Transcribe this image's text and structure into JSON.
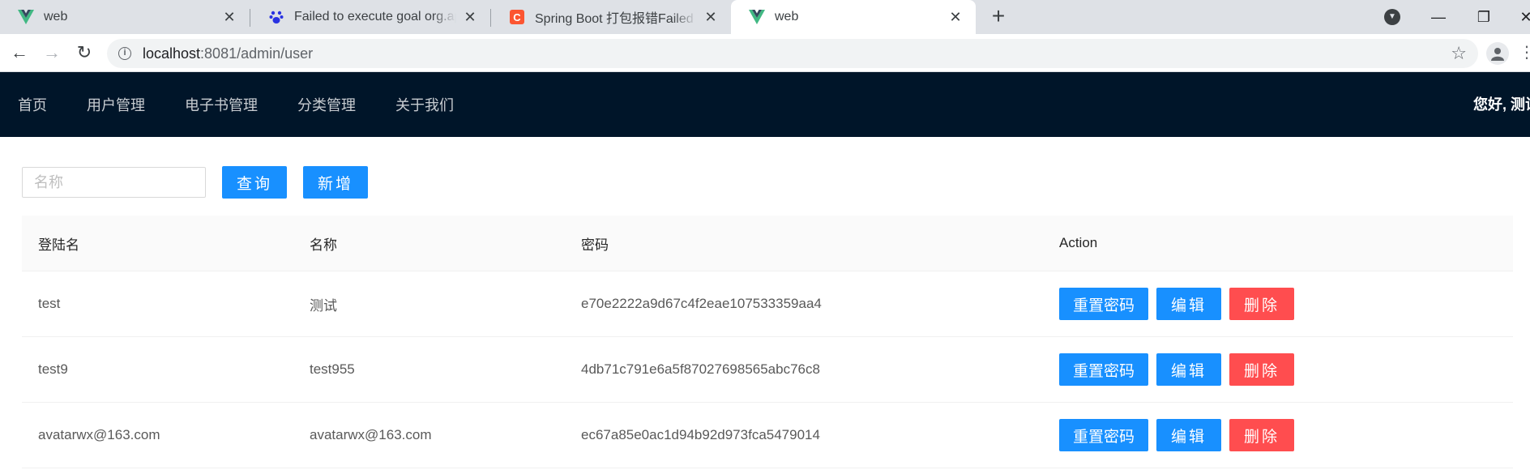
{
  "browser": {
    "tabs": [
      {
        "title": "web",
        "icon": "vue-icon"
      },
      {
        "title": "Failed to execute goal org.apache",
        "icon": "baidu-paw-icon"
      },
      {
        "title": "Spring Boot 打包报错Failed to execute",
        "icon": "csdn-icon"
      },
      {
        "title": "web",
        "icon": "vue-icon"
      }
    ],
    "address": {
      "host": "localhost",
      "path": ":8081/admin/user"
    },
    "colors": {
      "vue_green": "#41b883",
      "vue_dark": "#35495e",
      "csdn_red": "#fc5531",
      "baidu_blue": "#2932e1"
    }
  },
  "header": {
    "nav": [
      "首页",
      "用户管理",
      "电子书管理",
      "分类管理",
      "关于我们"
    ],
    "greeting": "您好, 测试"
  },
  "toolbar": {
    "search_placeholder": "名称",
    "query_label": "查询",
    "add_label": "新增"
  },
  "table": {
    "columns": [
      "登陆名",
      "名称",
      "密码",
      "Action"
    ],
    "rows": [
      {
        "login": "test",
        "name": "测试",
        "password": "e70e2222a9d67c4f2eae107533359aa4"
      },
      {
        "login": "test9",
        "name": "test955",
        "password": "4db71c791e6a5f87027698565abc76c8"
      },
      {
        "login": "avatarwx@163.com",
        "name": "avatarwx@163.com",
        "password": "ec67a85e0ac1d94b92d973fca5479014"
      }
    ],
    "actions": {
      "reset": "重置密码",
      "edit": "编辑",
      "delete": "删除"
    }
  },
  "theme": {
    "header_bg": "#001529",
    "primary": "#1890ff",
    "danger": "#ff4d4f"
  }
}
